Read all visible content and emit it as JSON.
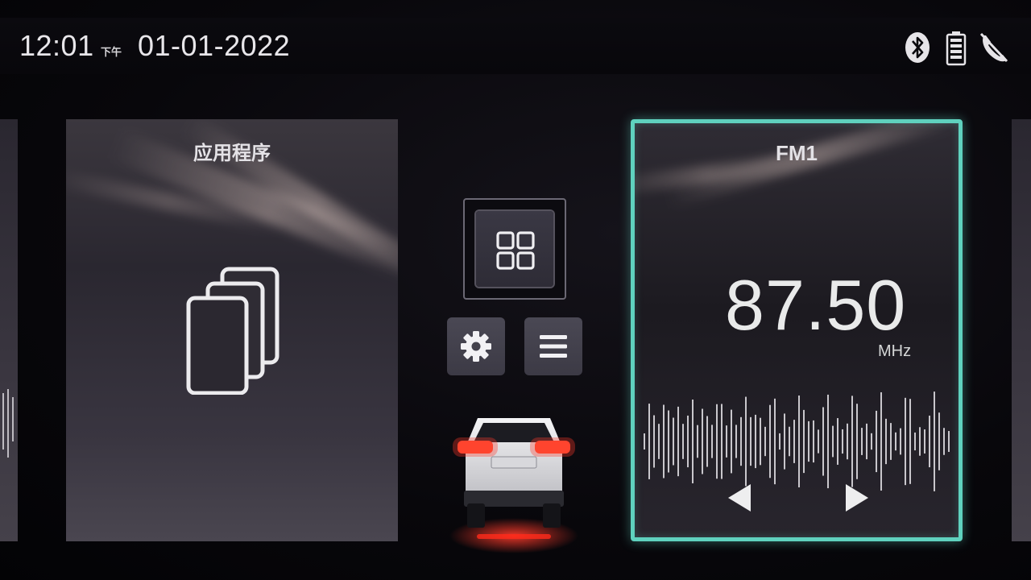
{
  "status_bar": {
    "time": "12:01",
    "ampm": "下午",
    "date": "01-01-2022",
    "icons": [
      "bluetooth-icon",
      "battery-icon",
      "phone-icon"
    ]
  },
  "apps_card": {
    "title": "应用程序",
    "icon": "apps-stack-icon"
  },
  "center_controls": {
    "grid_icon": "grid-icon",
    "settings_icon": "gear-icon",
    "menu_icon": "menu-icon",
    "vehicle_icon": "car-icon"
  },
  "radio_card": {
    "band": "FM1",
    "frequency": "87.50",
    "unit": "MHz",
    "prev_icon": "prev-station-icon",
    "next_icon": "next-station-icon"
  },
  "colors": {
    "accent": "#5fd1be",
    "text": "#e8e6ea",
    "tail_light": "#ff3a2a"
  }
}
